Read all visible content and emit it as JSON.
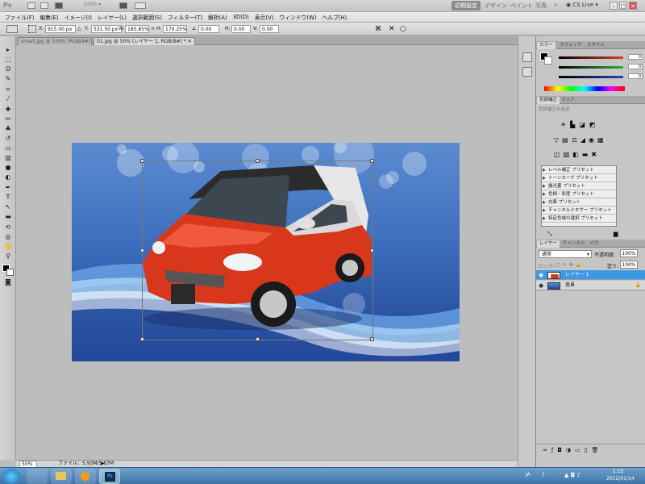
{
  "titlebar": {
    "zoom_value": "100%",
    "workspaces": [
      "初期設定",
      "デザイン",
      "ペイント",
      "写真"
    ],
    "active_workspace": "初期設定",
    "more": "»",
    "cs_live": "CS Live"
  },
  "menu": [
    "ファイル(F)",
    "編集(E)",
    "イメージ(I)",
    "レイヤー(L)",
    "選択範囲(S)",
    "フィルター(T)",
    "解析(A)",
    "3D(D)",
    "表示(V)",
    "ウィンドウ(W)",
    "ヘルプ(H)"
  ],
  "options": {
    "x_label": "X:",
    "x_value": "915.00 px",
    "y_label": "Y:",
    "y_value": "531.50 px",
    "w_label": "W:",
    "w_value": "185.85%",
    "h_label": "H:",
    "h_value": "170.25%",
    "angle_value": "0.00",
    "skew_h_label": "H:",
    "skew_h_value": "0.00",
    "skew_v_label": "V:",
    "skew_v_value": "0.00"
  },
  "tabs": [
    {
      "label": "smart.jpg @ 100% (RGB/8#)",
      "active": false
    },
    {
      "label": "01.jpg @ 50% (レイヤー 1, RGB/8#) *",
      "active": true
    }
  ],
  "status": {
    "zoom": "50%",
    "file_info": "ファイル：5.93M/5.87M"
  },
  "color_panel": {
    "tabs": [
      "カラー",
      "スウォッチ",
      "スタイル"
    ],
    "channels": [
      {
        "name": "R",
        "value": "0",
        "color": "#e23b2e"
      },
      {
        "name": "G",
        "value": "0",
        "color": "#2fae3a"
      },
      {
        "name": "B",
        "value": "0",
        "color": "#2b42c8"
      }
    ]
  },
  "adjust_panel": {
    "tabs": [
      "色調補正",
      "マスク"
    ],
    "subtitle": "色調補正を追加",
    "presets": [
      "レベル補正 プリセット",
      "トーンカーブ プリセット",
      "露光量 プリセット",
      "色相・彩度 プリセット",
      "白黒 プリセット",
      "チャンネルミキサー プリセット",
      "特定色域の選択 プリセット"
    ]
  },
  "layers_panel": {
    "tabs": [
      "レイヤー",
      "チャンネル",
      "パス"
    ],
    "blend_mode": "通常",
    "opacity_label": "不透明度:",
    "opacity_value": "100%",
    "lock_label": "ロック:",
    "fill_label": "塗り:",
    "fill_value": "100%",
    "layers": [
      {
        "name": "レイヤー 1",
        "selected": true
      },
      {
        "name": "背景",
        "selected": false
      }
    ]
  },
  "taskbar": {
    "lang": "JA",
    "time": "1:15",
    "date": "2012/01/14"
  },
  "colors": {
    "accent_selected": "#3b9ae8",
    "car_body": "#d8371c",
    "bg_blue": "#3d6fbe"
  }
}
